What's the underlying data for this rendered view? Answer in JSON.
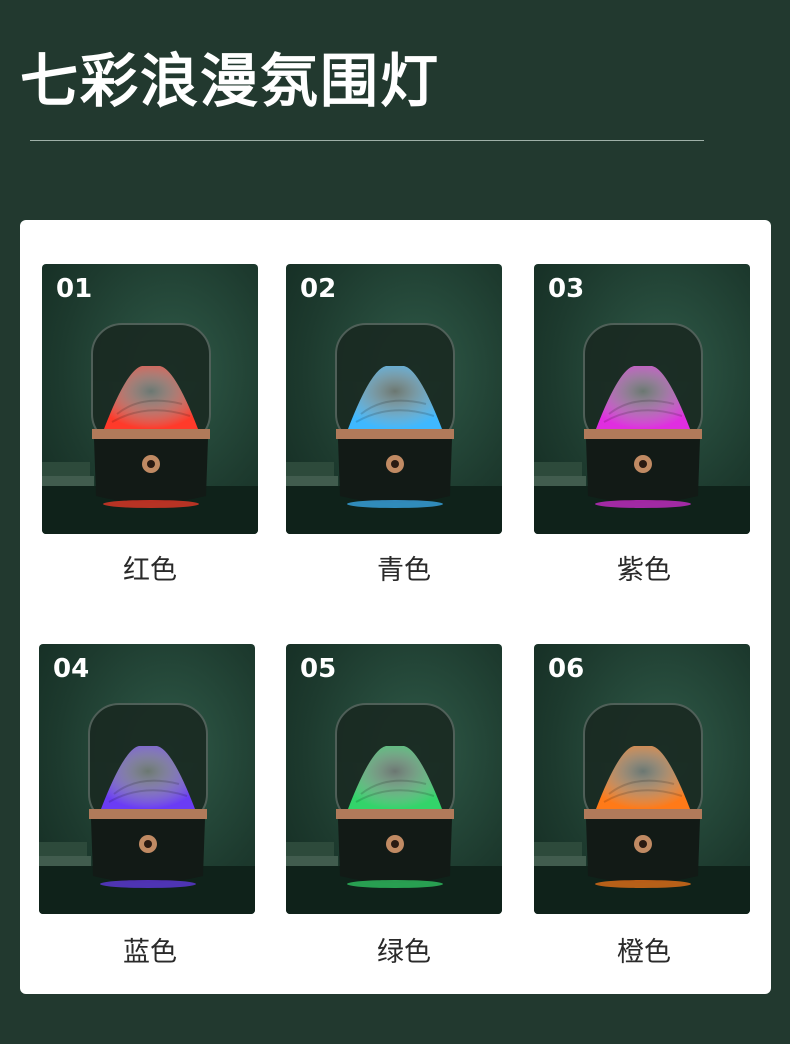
{
  "page": {
    "title": "七彩浪漫氛围灯"
  },
  "colors": {
    "background": "#22392f",
    "panel": "#ffffff",
    "text_dark": "#2a2a2a"
  },
  "lamps": [
    {
      "number": "01",
      "name": "红色",
      "glow": "#ff3a2a"
    },
    {
      "number": "02",
      "name": "青色",
      "glow": "#3fb8ff"
    },
    {
      "number": "03",
      "name": "紫色",
      "glow": "#e02ee0"
    },
    {
      "number": "04",
      "name": "蓝色",
      "glow": "#6a3cf5"
    },
    {
      "number": "05",
      "name": "绿色",
      "glow": "#33d46a"
    },
    {
      "number": "06",
      "name": "橙色",
      "glow": "#ff7a18"
    }
  ]
}
